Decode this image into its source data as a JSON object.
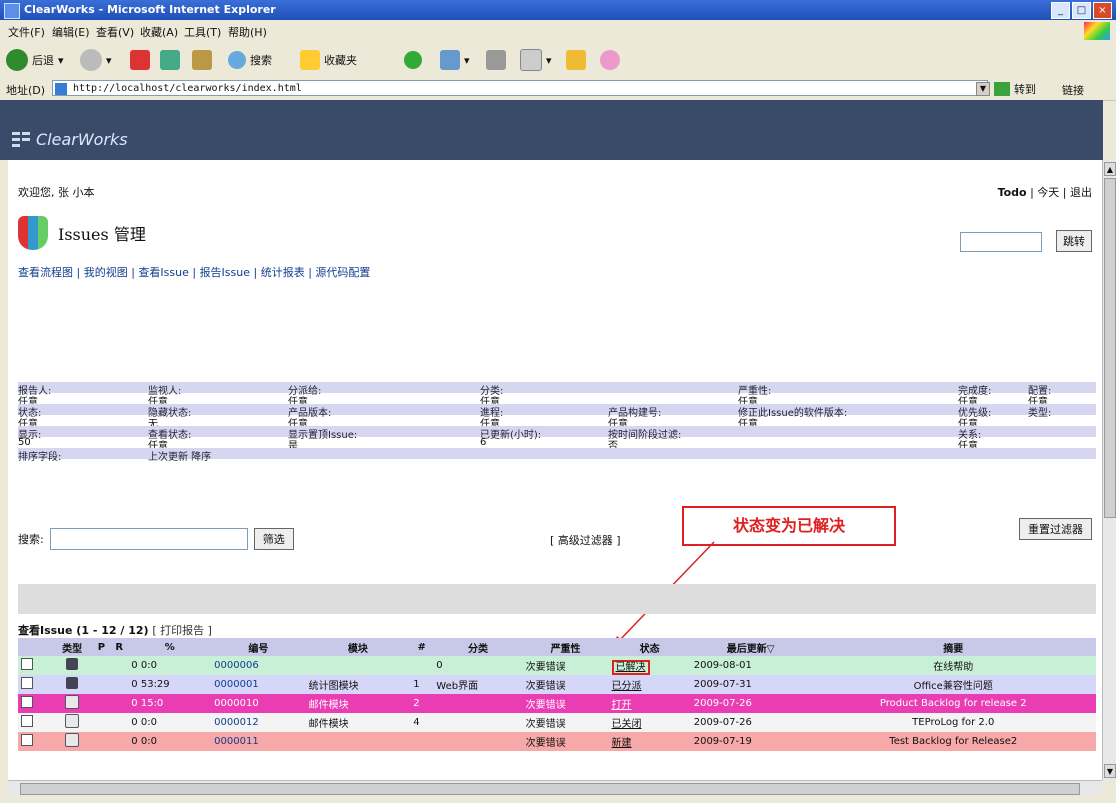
{
  "window": {
    "title": "ClearWorks - Microsoft Internet Explorer"
  },
  "menu": {
    "items": [
      "文件(F)",
      "编辑(E)",
      "查看(V)",
      "收藏(A)",
      "工具(T)",
      "帮助(H)"
    ]
  },
  "toolbar": {
    "back": "后退",
    "search": "搜索",
    "favorites": "收藏夹"
  },
  "address": {
    "label": "地址(D)",
    "url": "http://localhost/clearworks/index.html",
    "go": "转到",
    "links": "链接"
  },
  "app": {
    "logo": "ClearWorks"
  },
  "page": {
    "welcome": "欢迎您, 张 小本",
    "toplinks": {
      "todo": "Todo",
      "today": "今天",
      "logout": "退出"
    },
    "title": "Issues 管理",
    "search_button": "跳转",
    "nav": [
      "查看流程图",
      "我的视图",
      "查看Issue",
      "报告Issue",
      "统计报表",
      "源代码配置"
    ]
  },
  "filters": {
    "rows": [
      [
        "报告人:",
        "监视人:",
        "分派给:",
        "分类:",
        "",
        "严重性:",
        "完成度:",
        "配置:"
      ],
      [
        "任意",
        "任意",
        "任意",
        "任意",
        "",
        "任意",
        "任意",
        "任意"
      ],
      [
        "状态:",
        "隐藏状态:",
        "产品版本:",
        "進程:",
        "产品构建号:",
        "修正此Issue的软件版本:",
        "优先级:",
        "类型:"
      ],
      [
        "任意",
        "无",
        "任意",
        "任意",
        "任意",
        "任意",
        "任意",
        ""
      ],
      [
        "显示:",
        "查看状态:",
        "显示置顶Issue:",
        "已更新(小时):",
        "按时间阶段过滤:",
        "",
        "关系:",
        ""
      ],
      [
        "50",
        "任意",
        "是",
        "6",
        "否",
        "",
        "任意",
        ""
      ],
      [
        "排序字段:",
        "上次更新 降序",
        "",
        "",
        "",
        "",
        "",
        ""
      ]
    ]
  },
  "filterbar": {
    "search_label": "搜索:",
    "filter_button": "筛选",
    "advanced": "[ 高级过滤器 ]",
    "reset": "重置过滤器"
  },
  "annotation": {
    "text": "状态变为已解决"
  },
  "list": {
    "title": "查看Issue (1 - 12 / 12)",
    "print": "[ 打印报告 ]",
    "columns": [
      "",
      "类型",
      "P",
      "R",
      "%",
      "编号",
      "模块",
      "#",
      "分类",
      "严重性",
      "状态",
      "最后更新▽",
      "摘要"
    ],
    "rows": [
      [
        "",
        "",
        "",
        "",
        "0 0:0",
        "0000006",
        "",
        "",
        "0",
        "次要错误",
        "已解决",
        "2009-08-01",
        "在线帮助"
      ],
      [
        "",
        "",
        "",
        "",
        "0 53:29",
        "0000001",
        "统计图模块",
        "1",
        "Web界面",
        "次要错误",
        "已分派",
        "2009-07-31",
        "Office兼容性问题"
      ],
      [
        "",
        "",
        "",
        "",
        "0 15:0",
        "0000010",
        "邮件模块",
        "2",
        "",
        "次要错误",
        "打开",
        "2009-07-26",
        "Product Backlog for release 2"
      ],
      [
        "",
        "",
        "",
        "",
        "0 0:0",
        "0000012",
        "邮件模块",
        "4",
        "",
        "次要错误",
        "已关闭",
        "2009-07-26",
        "TEProLog for 2.0"
      ],
      [
        "",
        "",
        "",
        "",
        "0 0:0",
        "0000011",
        "",
        "",
        "",
        "次要错误",
        "新建",
        "2009-07-19",
        "Test Backlog for Release2"
      ]
    ]
  }
}
